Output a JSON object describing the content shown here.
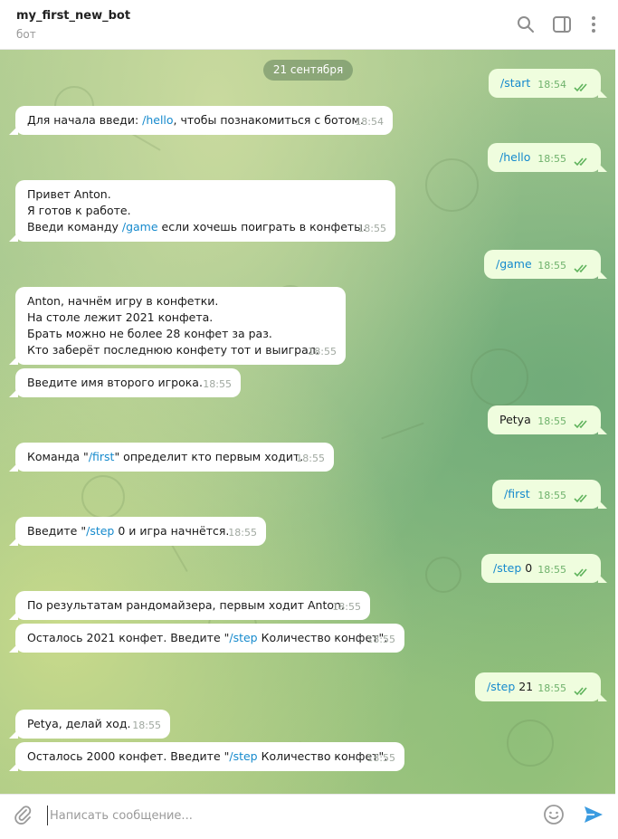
{
  "header": {
    "title": "my_first_new_bot",
    "subtitle": "бот",
    "icons": [
      "search-icon",
      "sidebar-toggle-icon",
      "more-vertical-icon"
    ]
  },
  "chat": {
    "date": "21 сентября",
    "messages": [
      {
        "dir": "out",
        "parts": [
          {
            "t": "/start",
            "c": true
          }
        ],
        "time": "18:54",
        "read": true
      },
      {
        "dir": "in",
        "lines": [
          [
            {
              "t": "Для начала введи: "
            },
            {
              "t": "/hello",
              "c": true
            },
            {
              "t": ", чтобы познакомиться с ботом."
            }
          ]
        ],
        "time": "18:54"
      },
      {
        "dir": "out",
        "parts": [
          {
            "t": "/hello",
            "c": true
          }
        ],
        "time": "18:55",
        "read": true
      },
      {
        "dir": "in",
        "lines": [
          [
            {
              "t": "Привет Anton."
            }
          ],
          [
            {
              "t": "Я готов к работе."
            }
          ],
          [
            {
              "t": "Введи команду "
            },
            {
              "t": "/game",
              "c": true
            },
            {
              "t": " если хочешь поиграть в конфеты."
            }
          ]
        ],
        "time": "18:55"
      },
      {
        "dir": "out",
        "parts": [
          {
            "t": "/game",
            "c": true
          }
        ],
        "time": "18:55",
        "read": true
      },
      {
        "dir": "in",
        "lines": [
          [
            {
              "t": "Anton, начнём игру в конфетки."
            }
          ],
          [
            {
              "t": "На столе лежит 2021 конфета."
            }
          ],
          [
            {
              "t": "Брать можно не более 28 конфет за раз."
            }
          ],
          [
            {
              "t": "Кто заберёт последнюю конфету тот и выиграл."
            }
          ]
        ],
        "time": "18:55"
      },
      {
        "dir": "in",
        "lines": [
          [
            {
              "t": "Введите имя второго игрока."
            }
          ]
        ],
        "time": "18:55"
      },
      {
        "dir": "out",
        "parts": [
          {
            "t": "Petya"
          }
        ],
        "time": "18:55",
        "read": true
      },
      {
        "dir": "in",
        "lines": [
          [
            {
              "t": "Команда \""
            },
            {
              "t": "/first",
              "c": true
            },
            {
              "t": "\" определит кто первым ходит."
            }
          ]
        ],
        "time": "18:55"
      },
      {
        "dir": "out",
        "parts": [
          {
            "t": "/first",
            "c": true
          }
        ],
        "time": "18:55",
        "read": true
      },
      {
        "dir": "in",
        "lines": [
          [
            {
              "t": "Введите \""
            },
            {
              "t": "/step",
              "c": true
            },
            {
              "t": " 0 и игра начнётся."
            }
          ]
        ],
        "time": "18:55"
      },
      {
        "dir": "out",
        "parts": [
          {
            "t": "/step",
            "c": true
          },
          {
            "t": " 0"
          }
        ],
        "time": "18:55",
        "read": true
      },
      {
        "dir": "in",
        "lines": [
          [
            {
              "t": "По результатам рандомайзера, первым ходит Anton."
            }
          ]
        ],
        "time": "18:55"
      },
      {
        "dir": "in",
        "lines": [
          [
            {
              "t": "Осталось 2021 конфет. Введите \""
            },
            {
              "t": "/step",
              "c": true
            },
            {
              "t": " Количество конфет\"."
            }
          ]
        ],
        "time": "18:55"
      },
      {
        "dir": "out",
        "parts": [
          {
            "t": "/step",
            "c": true
          },
          {
            "t": " 21"
          }
        ],
        "time": "18:55",
        "read": true
      },
      {
        "dir": "in",
        "lines": [
          [
            {
              "t": "Petya, делай ход."
            }
          ]
        ],
        "time": "18:55"
      },
      {
        "dir": "in",
        "lines": [
          [
            {
              "t": "Осталось 2000 конфет. Введите \""
            },
            {
              "t": "/step",
              "c": true
            },
            {
              "t": " Количество конфет\"."
            }
          ]
        ],
        "time": "18:55"
      }
    ]
  },
  "composer": {
    "placeholder": "Написать сообщение...",
    "icons": [
      "attach-icon",
      "emoji-icon",
      "send-icon"
    ]
  },
  "colors": {
    "incoming_bubble": "#ffffff",
    "outgoing_bubble": "#effdde",
    "command_link": "#168acd",
    "send_accent": "#3a9be0",
    "read_ticks": "#5fb35c"
  }
}
